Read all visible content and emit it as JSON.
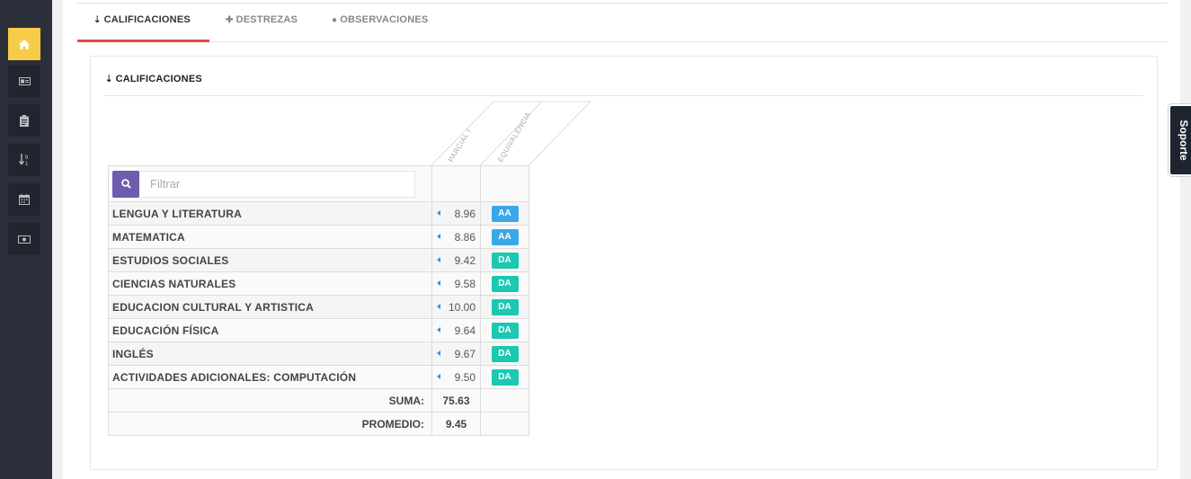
{
  "sidebar": {
    "items": [
      {
        "icon": "home-icon",
        "active": true
      },
      {
        "icon": "id-card-icon",
        "active": false
      },
      {
        "icon": "clipboard-icon",
        "active": false
      },
      {
        "icon": "sort-numeric-icon",
        "active": false
      },
      {
        "icon": "calendar-icon",
        "active": false
      },
      {
        "icon": "money-icon",
        "active": false
      }
    ],
    "accent_color": "#f7cc4a"
  },
  "tabs": [
    {
      "label": "CALIFICACIONES",
      "icon": "sort-numeric-icon",
      "active": true
    },
    {
      "label": "DESTREZAS",
      "icon": "puzzle-icon",
      "active": false
    },
    {
      "label": "OBSERVACIONES",
      "icon": "comments-icon",
      "active": false
    }
  ],
  "panel": {
    "title": "CALIFICACIONES",
    "title_icon": "sort-numeric-icon"
  },
  "table": {
    "column_headers": [
      "PARCIAL I",
      "EQUIVALENCIA"
    ],
    "filter_placeholder": "Filtrar",
    "rows": [
      {
        "subject": "LENGUA Y LITERATURA",
        "grade": "8.96",
        "equivalence": "AA"
      },
      {
        "subject": "MATEMATICA",
        "grade": "8.86",
        "equivalence": "AA"
      },
      {
        "subject": "ESTUDIOS SOCIALES",
        "grade": "9.42",
        "equivalence": "DA"
      },
      {
        "subject": "CIENCIAS NATURALES",
        "grade": "9.58",
        "equivalence": "DA"
      },
      {
        "subject": "EDUCACION CULTURAL Y ARTISTICA",
        "grade": "10.00",
        "equivalence": "DA"
      },
      {
        "subject": "EDUCACIÓN FÍSICA",
        "grade": "9.64",
        "equivalence": "DA"
      },
      {
        "subject": "INGLÉS",
        "grade": "9.67",
        "equivalence": "DA"
      },
      {
        "subject": "ACTIVIDADES ADICIONALES: COMPUTACIÓN",
        "grade": "9.50",
        "equivalence": "DA"
      }
    ],
    "sum_label": "SUMA:",
    "sum_value": "75.63",
    "avg_label": "PROMEDIO:",
    "avg_value": "9.45",
    "badge_colors": {
      "AA": "#3aa8e8",
      "DA": "#1bc8b0"
    }
  },
  "support_tab": {
    "label": "Soporte"
  }
}
